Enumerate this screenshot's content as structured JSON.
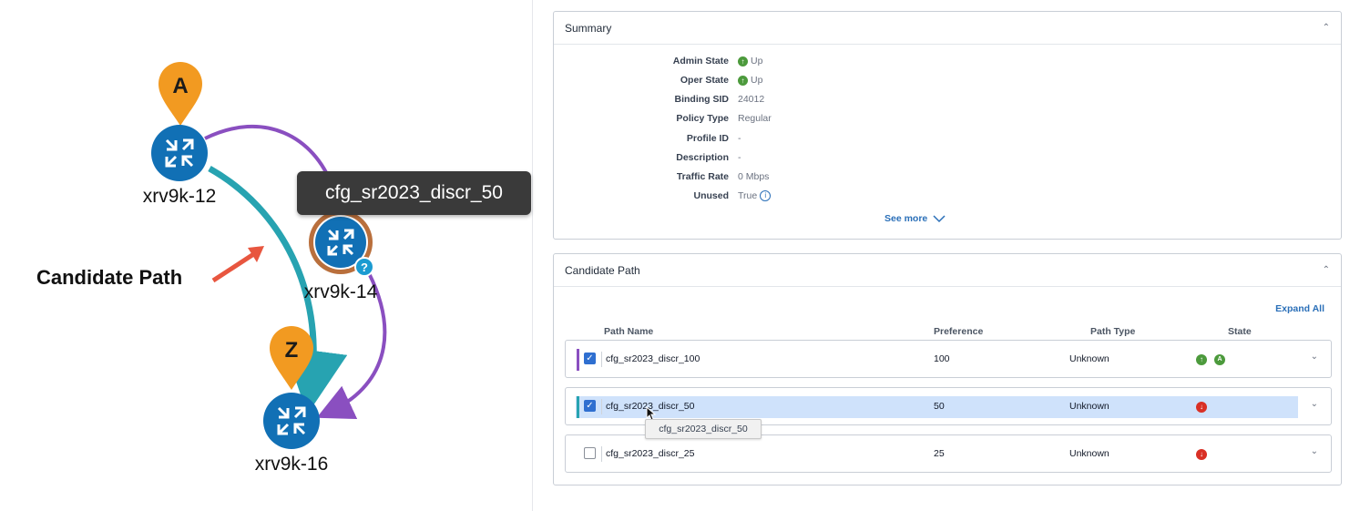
{
  "topology": {
    "nodes": [
      {
        "name": "xrv9k-12",
        "marker": "A"
      },
      {
        "name": "xrv9k-14"
      },
      {
        "name": "xrv9k-16",
        "marker": "Z"
      }
    ],
    "tooltip": "cfg_sr2023_discr_50",
    "callout_label": "Candidate Path",
    "colors": {
      "node": "#1170b5",
      "marker": "#f29a21",
      "path_purple": "#8a4fc0",
      "path_teal": "#27a3b1",
      "ring": "#b96f3c"
    }
  },
  "summary": {
    "title": "Summary",
    "fields": [
      {
        "label": "Admin State",
        "value": "Up",
        "icon": "up-arrow-icon"
      },
      {
        "label": "Oper State",
        "value": "Up",
        "icon": "up-arrow-icon"
      },
      {
        "label": "Binding SID",
        "value": "24012"
      },
      {
        "label": "Policy Type",
        "value": "Regular"
      },
      {
        "label": "Profile ID",
        "value": "-"
      },
      {
        "label": "Description",
        "value": "-"
      },
      {
        "label": "Traffic Rate",
        "value": "0 Mbps"
      },
      {
        "label": "Unused",
        "value": "True",
        "icon": "info-icon"
      }
    ],
    "see_more": "See more"
  },
  "candidate_path": {
    "title": "Candidate Path",
    "expand_all": "Expand All",
    "columns": [
      "Path Name",
      "Preference",
      "Path Type",
      "State"
    ],
    "rows": [
      {
        "name": "cfg_sr2023_discr_100",
        "preference": "100",
        "type": "Unknown",
        "checked": true,
        "color": "#8a4fc0",
        "state": [
          "up-arrow-icon",
          "active-icon"
        ]
      },
      {
        "name": "cfg_sr2023_discr_50",
        "preference": "50",
        "type": "Unknown",
        "checked": true,
        "color": "#27a3b1",
        "state": [
          "down-arrow-icon"
        ],
        "selected": true
      },
      {
        "name": "cfg_sr2023_discr_25",
        "preference": "25",
        "type": "Unknown",
        "checked": false,
        "color": "",
        "state": [
          "down-arrow-icon"
        ]
      }
    ],
    "hover_tooltip": "cfg_sr2023_discr_50"
  }
}
